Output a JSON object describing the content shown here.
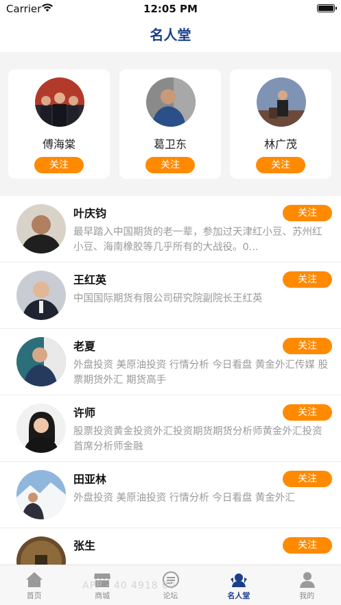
{
  "status_bar": {
    "carrier": "Carrier",
    "time": "12:05 PM"
  },
  "nav": {
    "title": "名人堂"
  },
  "featured": [
    {
      "name": "傅海棠",
      "follow": "关注"
    },
    {
      "name": "葛卫东",
      "follow": "关注"
    },
    {
      "name": "林广茂",
      "follow": "关注"
    }
  ],
  "list": [
    {
      "name": "叶庆钧",
      "desc": "最早踏入中国期货的老一辈，参加过天津红小豆、苏州红小豆、海南橡胶等几乎所有的大战役。0...",
      "follow": "关注"
    },
    {
      "name": "王红英",
      "desc": "中国国际期货有限公司研究院副院长王红英",
      "follow": "关注"
    },
    {
      "name": "老夏",
      "desc": "外盘投资 美原油投资 行情分析 今日看盘 黄金外汇传媒 股票期货外汇 期货高手",
      "follow": "关注"
    },
    {
      "name": "许师",
      "desc": "股票投资黄金投资外汇投资期货期货分析师黄金外汇投资首席分析师金融",
      "follow": "关注"
    },
    {
      "name": "田亚林",
      "desc": "外盘投资 美原油投资 行情分析 今日看盘 黄金外汇",
      "follow": "关注"
    },
    {
      "name": "张生",
      "desc": "",
      "follow": "关注"
    }
  ],
  "tabbar": {
    "tabs": [
      {
        "label": "首页",
        "icon": "home-icon"
      },
      {
        "label": "商城",
        "icon": "store-icon"
      },
      {
        "label": "论坛",
        "icon": "forum-icon"
      },
      {
        "label": "名人堂",
        "icon": "hall-of-fame-icon",
        "active": true
      },
      {
        "label": "我的",
        "icon": "profile-icon"
      }
    ]
  },
  "watermark": "APP · 40 4918 00",
  "colors": {
    "accent": "#ff8a00",
    "title": "#1a3e8c",
    "muted": "#9a9a9a"
  }
}
